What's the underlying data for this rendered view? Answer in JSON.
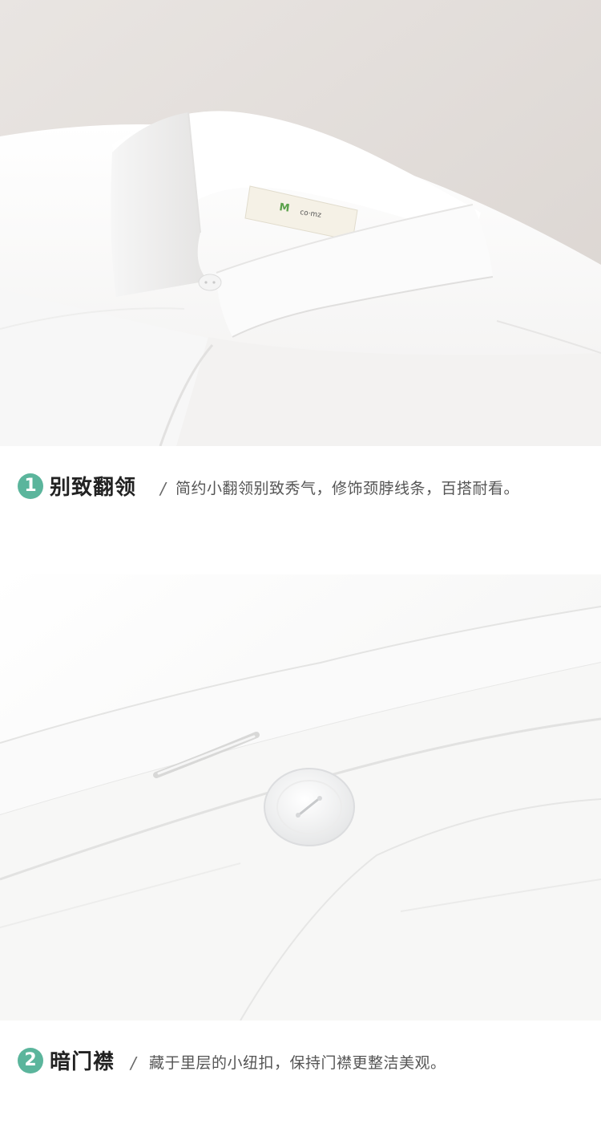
{
  "features": [
    {
      "number": "1",
      "title": "别致翻领",
      "separator": "/",
      "description": "简约小翻领别致秀气，修饰颈脖线条，百搭耐看。"
    },
    {
      "number": "2",
      "title": "暗门襟",
      "separator": "/",
      "description": "藏于里层的小纽扣，保持门襟更整洁美观。"
    }
  ],
  "accent_color": "#5bb59c"
}
